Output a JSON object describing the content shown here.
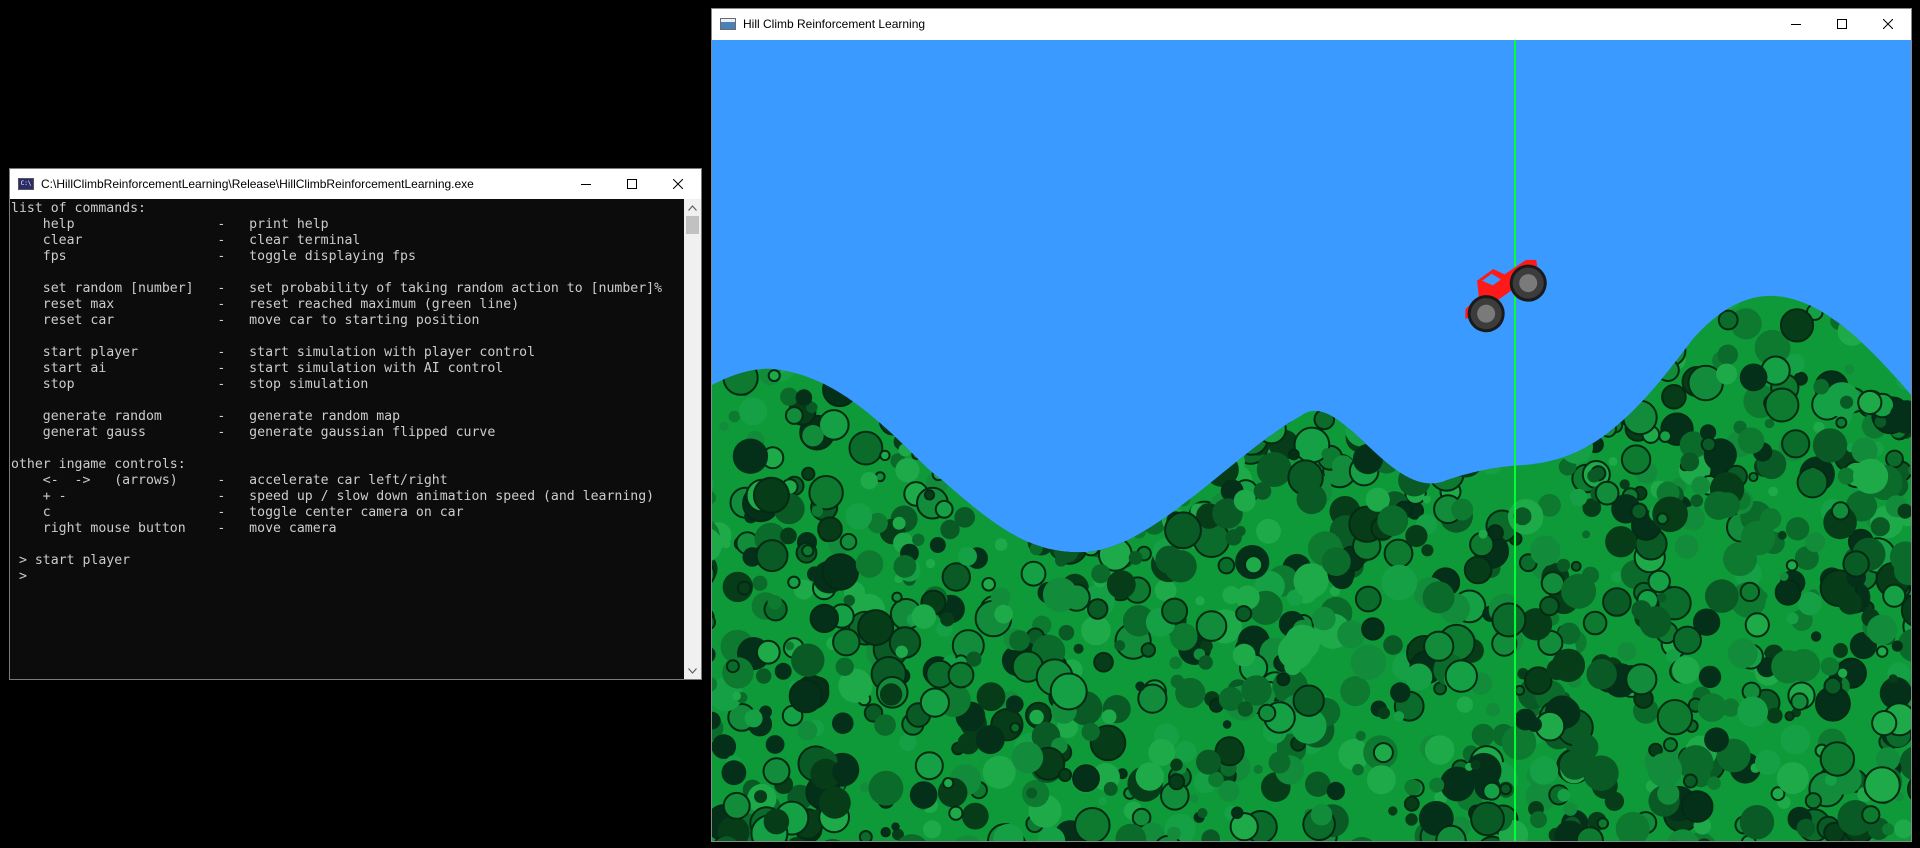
{
  "console": {
    "title": "C:\\HillClimbReinforcementLearning\\Release\\HillClimbReinforcementLearning.exe",
    "icon": "console-app-icon",
    "lines": [
      "list of commands:",
      "    help                  -   print help",
      "    clear                 -   clear terminal",
      "    fps                   -   toggle displaying fps",
      "",
      "    set random [number]   -   set probability of taking random action to [number]%",
      "    reset max             -   reset reached maximum (green line)",
      "    reset car             -   move car to starting position",
      "",
      "    start player          -   start simulation with player control",
      "    start ai              -   start simulation with AI control",
      "    stop                  -   stop simulation",
      "",
      "    generate random       -   generate random map",
      "    generat gauss         -   generate gaussian flipped curve",
      "",
      "other ingame controls:",
      "    <-  ->   (arrows)     -   accelerate car left/right",
      "    + -                   -   speed up / slow down animation speed (and learning)",
      "    c                     -   toggle center camera on car",
      "    right mouse button    -   move camera",
      "",
      " > start player",
      " >"
    ]
  },
  "game": {
    "title": "Hill Climb Reinforcement Learning",
    "icon": "window-app-icon",
    "colors": {
      "sky": "#3a9aff",
      "ground_base": "#0f9a3a",
      "max_line": "#00ff33",
      "car": "#ff1a1a",
      "wheel": "#3c3c3c"
    }
  },
  "window_controls": {
    "minimize_icon": "minimize-icon",
    "maximize_icon": "maximize-icon",
    "close_icon": "close-icon"
  }
}
